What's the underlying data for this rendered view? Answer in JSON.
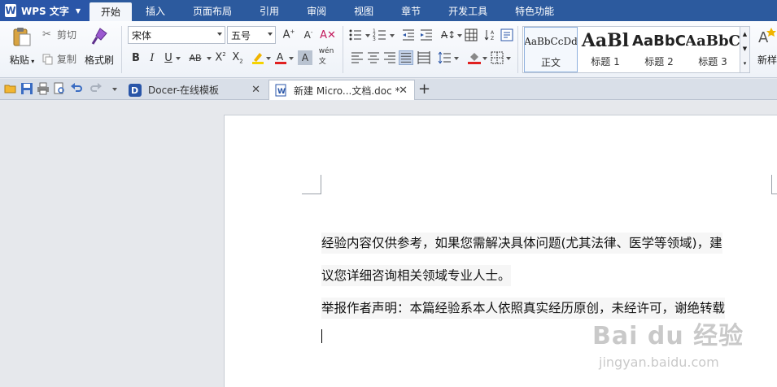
{
  "app": {
    "name": "WPS 文字"
  },
  "menu": {
    "tabs": [
      "开始",
      "插入",
      "页面布局",
      "引用",
      "审阅",
      "视图",
      "章节",
      "开发工具",
      "特色功能"
    ],
    "active": "开始"
  },
  "clipboard": {
    "paste": "粘贴",
    "cut": "剪切",
    "copy": "复制",
    "format_painter": "格式刷"
  },
  "font": {
    "name": "宋体",
    "size": "五号"
  },
  "style_gallery": [
    {
      "sample": "AaBbCcDd",
      "label": "正文"
    },
    {
      "sample": "AaBl",
      "label": "标题 1"
    },
    {
      "sample": "AaBbC",
      "label": "标题 2"
    },
    {
      "sample": "AaBbC",
      "label": "标题 3"
    }
  ],
  "new_style": {
    "label": "新样"
  },
  "doc_tabs": [
    {
      "label": "Docer-在线模板",
      "active": false
    },
    {
      "label": "新建 Micro...文档.doc *",
      "active": true
    }
  ],
  "new_tab": {
    "label": "+"
  },
  "document": {
    "lines": [
      "经验内容仅供参考，如果您需解决具体问题(尤其法律、医学等领域)，建",
      "议您详细咨询相关领域专业人士。",
      "举报作者声明：本篇经验系本人依照真实经历原创，未经许可，谢绝转载"
    ]
  },
  "watermark": {
    "brand": "Bai du 经验",
    "url": "jingyan.baidu.com"
  },
  "colors": {
    "menu_bg": "#2c5a9e",
    "accent": "#2a56a8",
    "highlight": "#f5d300",
    "font_color": "#e02020"
  }
}
